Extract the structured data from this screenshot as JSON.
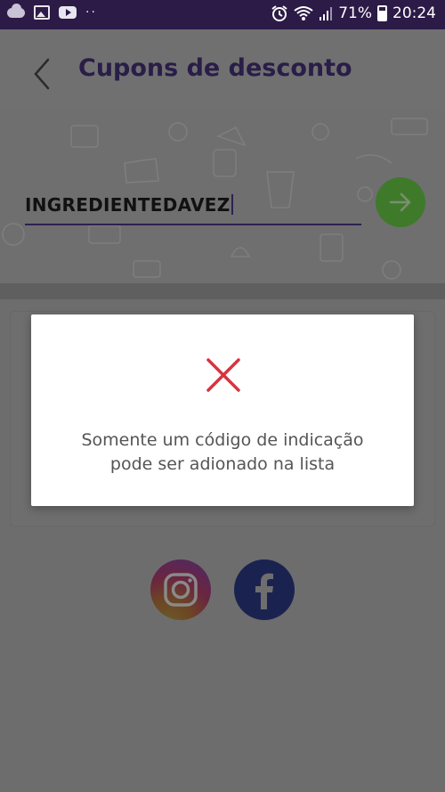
{
  "status_bar": {
    "battery": "71%",
    "time": "20:24",
    "dots": "··"
  },
  "header": {
    "title": "Cupons de desconto"
  },
  "coupon": {
    "code_value": "INGREDIENTEDAVEZ"
  },
  "dialog": {
    "message_line1": "Somente um código de indicação",
    "message_line2": "pode ser adionado na lista"
  },
  "colors": {
    "status_bar": "#2c1a47",
    "title": "#2a1d48",
    "go_button": "#3f7a2a",
    "error_x": "#d6343f",
    "facebook": "#1a2350"
  },
  "icons": {
    "back": "chevron-left-icon",
    "go": "arrow-right-icon",
    "error": "close-icon",
    "instagram": "instagram-icon",
    "facebook": "facebook-icon"
  }
}
